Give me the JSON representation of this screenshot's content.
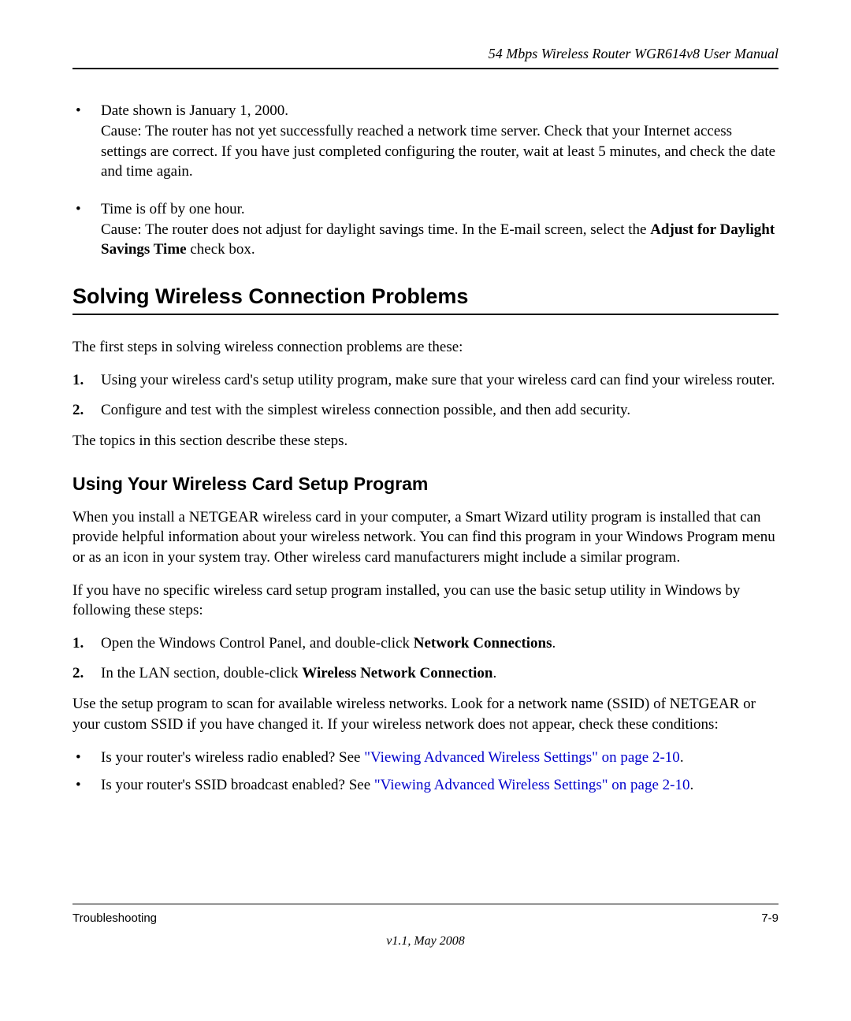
{
  "header": {
    "title": "54 Mbps Wireless Router WGR614v8 User Manual"
  },
  "bullets_top": [
    {
      "line1": "Date shown is January 1, 2000.",
      "line2": "Cause: The router has not yet successfully reached a network time server. Check that your Internet access settings are correct. If you have just completed configuring the router, wait at least 5 minutes, and check the date and time again."
    },
    {
      "line1": "Time is off by one hour.",
      "line2_pre": "Cause: The router does not adjust for daylight savings time. In the E-mail screen, select the ",
      "line2_bold": "Adjust for Daylight Savings Time",
      "line2_post": " check box."
    }
  ],
  "heading1": "Solving Wireless Connection Problems",
  "para1": "The first steps in solving wireless connection problems are these:",
  "ordered1": [
    {
      "num": "1.",
      "text": "Using your wireless card's setup utility program, make sure that your wireless card can find your wireless router."
    },
    {
      "num": "2.",
      "text": "Configure and test with the simplest wireless connection possible, and then add security."
    }
  ],
  "para2": "The topics in this section describe these steps.",
  "heading2": "Using Your Wireless Card Setup Program",
  "para3": "When you install a NETGEAR wireless card in your computer, a Smart Wizard utility program is installed that can provide helpful information about your wireless network. You can find this program in your Windows Program menu or as an icon in your system tray. Other wireless card manufacturers might include a similar program.",
  "para4": "If you have no specific wireless card setup program installed, you can use the basic setup utility in Windows by following these steps:",
  "ordered2": [
    {
      "num": "1.",
      "pre": "Open the Windows Control Panel, and double-click ",
      "bold": "Network Connections",
      "post": "."
    },
    {
      "num": "2.",
      "pre": "In the LAN section, double-click ",
      "bold": "Wireless Network Connection",
      "post": "."
    }
  ],
  "para5": "Use the setup program to scan for available wireless networks. Look for a network name (SSID) of NETGEAR or your custom SSID if you have changed it. If your wireless network does not appear, check these conditions:",
  "bullets_bottom": [
    {
      "pre": "Is your router's wireless radio enabled? See ",
      "link": "\"Viewing Advanced Wireless Settings\" on page 2-10",
      "post": "."
    },
    {
      "pre": "Is your router's SSID broadcast enabled? See ",
      "link": "\"Viewing Advanced Wireless Settings\" on page 2-10",
      "post": "."
    }
  ],
  "footer": {
    "left": "Troubleshooting",
    "right": "7-9",
    "version": "v1.1, May 2008"
  }
}
